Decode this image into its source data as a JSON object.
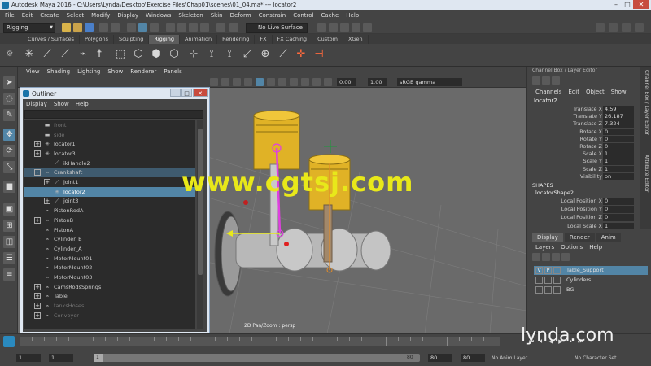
{
  "window": {
    "title": "Autodesk Maya 2016 - C:\\Users\\Lynda\\Desktop\\Exercise Files\\Chap01\\scenes\\01_04.ma* --- locator2"
  },
  "menubar": [
    "File",
    "Edit",
    "Create",
    "Select",
    "Modify",
    "Display",
    "Windows",
    "Skeleton",
    "Skin",
    "Deform",
    "Constrain",
    "Control",
    "Cache",
    "Help"
  ],
  "statusline": {
    "mode": "Rigging",
    "live_surface": "No Live Surface"
  },
  "shelf_tabs": [
    {
      "label": "Curves / Surfaces",
      "active": false
    },
    {
      "label": "Polygons",
      "active": false
    },
    {
      "label": "Sculpting",
      "active": false
    },
    {
      "label": "Rigging",
      "active": true
    },
    {
      "label": "Animation",
      "active": false
    },
    {
      "label": "Rendering",
      "active": false
    },
    {
      "label": "FX",
      "active": false
    },
    {
      "label": "FX Caching",
      "active": false
    },
    {
      "label": "Custom",
      "active": false
    },
    {
      "label": "XGen",
      "active": false
    }
  ],
  "viewport": {
    "menu": [
      "View",
      "Shading",
      "Lighting",
      "Show",
      "Renderer",
      "Panels"
    ],
    "near_value": "0.00",
    "far_value": "1.00",
    "color_space": "sRGB gamma",
    "camera_label": "2D Pan/Zoom : persp"
  },
  "outliner": {
    "title": "Outliner",
    "menu": [
      "Display",
      "Show",
      "Help"
    ],
    "rows": [
      {
        "label": "front",
        "indent": 0,
        "icon": "camera",
        "expander": "",
        "state": "dim"
      },
      {
        "label": "side",
        "indent": 0,
        "icon": "camera",
        "expander": "",
        "state": "dim"
      },
      {
        "label": "locator1",
        "indent": 0,
        "icon": "locator",
        "expander": "+",
        "state": ""
      },
      {
        "label": "locator3",
        "indent": 0,
        "icon": "locator",
        "expander": "+",
        "state": ""
      },
      {
        "label": "ikHandle2",
        "indent": 1,
        "icon": "ik",
        "expander": "",
        "state": ""
      },
      {
        "label": "Crankshaft",
        "indent": 0,
        "icon": "group",
        "expander": "-",
        "state": "child-sel"
      },
      {
        "label": "joint1",
        "indent": 1,
        "icon": "joint",
        "expander": "+",
        "state": ""
      },
      {
        "label": "locator2",
        "indent": 1,
        "icon": "locator",
        "expander": "",
        "state": "sel"
      },
      {
        "label": "joint3",
        "indent": 1,
        "icon": "joint",
        "expander": "+",
        "state": ""
      },
      {
        "label": "PistonRodA",
        "indent": 0,
        "icon": "group",
        "expander": "",
        "state": ""
      },
      {
        "label": "PistonB",
        "indent": 0,
        "icon": "group",
        "expander": "+",
        "state": ""
      },
      {
        "label": "PistonA",
        "indent": 0,
        "icon": "group",
        "expander": "",
        "state": ""
      },
      {
        "label": "Cylinder_B",
        "indent": 0,
        "icon": "group",
        "expander": "",
        "state": ""
      },
      {
        "label": "Cylinder_A",
        "indent": 0,
        "icon": "group",
        "expander": "",
        "state": ""
      },
      {
        "label": "MotorMount01",
        "indent": 0,
        "icon": "group",
        "expander": "",
        "state": ""
      },
      {
        "label": "MotorMount02",
        "indent": 0,
        "icon": "group",
        "expander": "",
        "state": ""
      },
      {
        "label": "MotorMount03",
        "indent": 0,
        "icon": "group",
        "expander": "",
        "state": ""
      },
      {
        "label": "CamsRodsSprings",
        "indent": 0,
        "icon": "group",
        "expander": "+",
        "state": ""
      },
      {
        "label": "Table",
        "indent": 0,
        "icon": "group",
        "expander": "+",
        "state": ""
      },
      {
        "label": "tanksHoses",
        "indent": 0,
        "icon": "group",
        "expander": "+",
        "state": "dim"
      },
      {
        "label": "Conveyor",
        "indent": 0,
        "icon": "group",
        "expander": "+",
        "state": "dim"
      }
    ]
  },
  "channel_box": {
    "header": "Channel Box / Layer Editor",
    "menu": [
      "Channels",
      "Edit",
      "Object",
      "Show"
    ],
    "object": "locator2",
    "attributes": [
      {
        "name": "Translate X",
        "value": "4.59"
      },
      {
        "name": "Translate Y",
        "value": "26.187"
      },
      {
        "name": "Translate Z",
        "value": "7.324"
      },
      {
        "name": "Rotate X",
        "value": "0"
      },
      {
        "name": "Rotate Y",
        "value": "0"
      },
      {
        "name": "Rotate Z",
        "value": "0"
      },
      {
        "name": "Scale X",
        "value": "1"
      },
      {
        "name": "Scale Y",
        "value": "1"
      },
      {
        "name": "Scale Z",
        "value": "1"
      },
      {
        "name": "Visibility",
        "value": "on"
      }
    ],
    "shapes_label": "SHAPES",
    "shape_name": "locatorShape2",
    "shape_attributes": [
      {
        "name": "Local Position X",
        "value": "0"
      },
      {
        "name": "Local Position Y",
        "value": "0"
      },
      {
        "name": "Local Position Z",
        "value": "0"
      },
      {
        "name": "Local Scale X",
        "value": "1"
      }
    ]
  },
  "side_tabs": [
    "Channel Box / Layer Editor",
    "Attribute Editor"
  ],
  "layer_editor": {
    "tabs": [
      {
        "label": "Display",
        "active": true
      },
      {
        "label": "Render",
        "active": false
      },
      {
        "label": "Anim",
        "active": false
      }
    ],
    "menu": [
      "Layers",
      "Options",
      "Help"
    ],
    "layers": [
      {
        "name": "Table_Support",
        "v": "V",
        "p": "P",
        "t": "T",
        "selected": true
      },
      {
        "name": "Cylinders",
        "v": "",
        "p": "",
        "t": "",
        "selected": false
      },
      {
        "name": "BG",
        "v": "",
        "p": "",
        "t": "",
        "selected": false
      }
    ]
  },
  "time": {
    "start": "1",
    "current_start": "1",
    "range_start": "1",
    "range_end": "80",
    "end_a": "80",
    "end_b": "80",
    "anim_layer": "No Anim Layer",
    "character_set": "No Character Set"
  },
  "overlay": {
    "watermark": "www.cgtsj.com",
    "brand": "lynda.com"
  },
  "colors": {
    "accent": "#5285a6",
    "watermark": "#e8e81a",
    "viewport_bg": "#6a6a6a"
  }
}
